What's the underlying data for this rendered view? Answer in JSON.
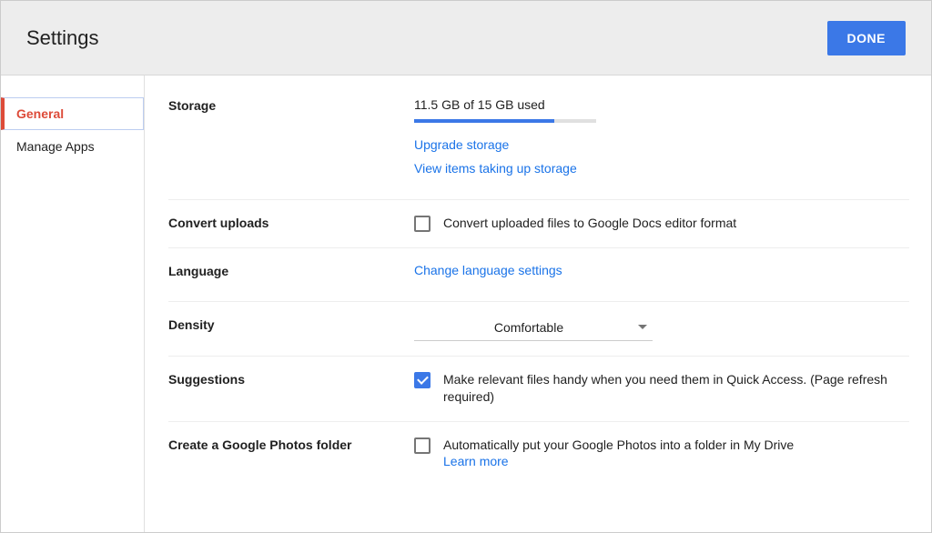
{
  "header": {
    "title": "Settings",
    "done_label": "DONE"
  },
  "sidebar": {
    "items": [
      {
        "label": "General",
        "active": true
      },
      {
        "label": "Manage Apps",
        "active": false
      }
    ]
  },
  "sections": {
    "storage": {
      "label": "Storage",
      "usage_text": "11.5 GB of 15 GB used",
      "upgrade_link": "Upgrade storage",
      "view_items_link": "View items taking up storage"
    },
    "convert": {
      "label": "Convert uploads",
      "checked": false,
      "desc": "Convert uploaded files to Google Docs editor format"
    },
    "language": {
      "label": "Language",
      "link": "Change language settings"
    },
    "density": {
      "label": "Density",
      "value": "Comfortable"
    },
    "suggestions": {
      "label": "Suggestions",
      "checked": true,
      "desc": "Make relevant files handy when you need them in Quick Access. (Page refresh required)"
    },
    "photos": {
      "label": "Create a Google Photos folder",
      "checked": false,
      "desc": "Automatically put your Google Photos into a folder in My Drive",
      "learn_more": "Learn more"
    }
  }
}
